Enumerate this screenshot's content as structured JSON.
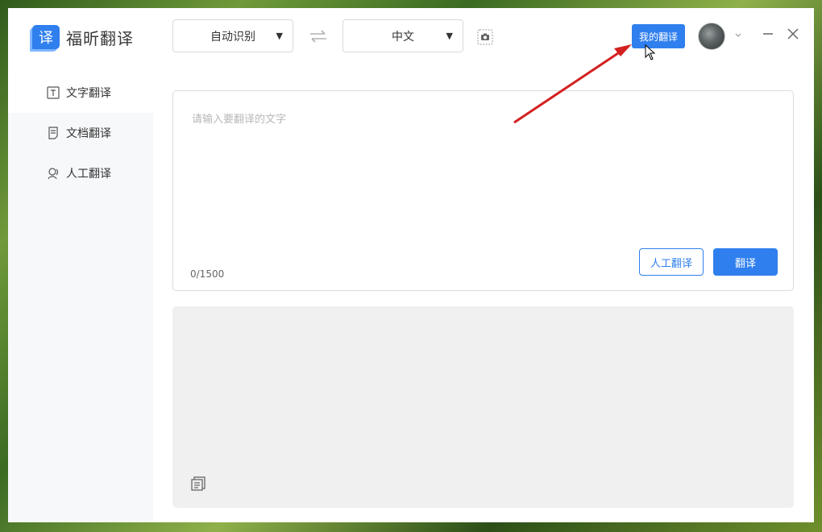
{
  "app": {
    "logo_badge": "译",
    "logo_text": "福昕翻译"
  },
  "toolbar": {
    "source_lang": "自动识别",
    "target_lang": "中文",
    "my_translation": "我的翻译"
  },
  "sidebar": {
    "items": [
      {
        "label": "文字翻译",
        "icon": "text-icon"
      },
      {
        "label": "文档翻译",
        "icon": "document-icon"
      },
      {
        "label": "人工翻译",
        "icon": "human-icon"
      }
    ]
  },
  "input": {
    "placeholder": "请输入要翻译的文字",
    "counter": "0/1500",
    "human_btn": "人工翻译",
    "translate_btn": "翻译"
  },
  "colors": {
    "accent": "#2f7fee",
    "annotation_arrow": "#d42020"
  }
}
